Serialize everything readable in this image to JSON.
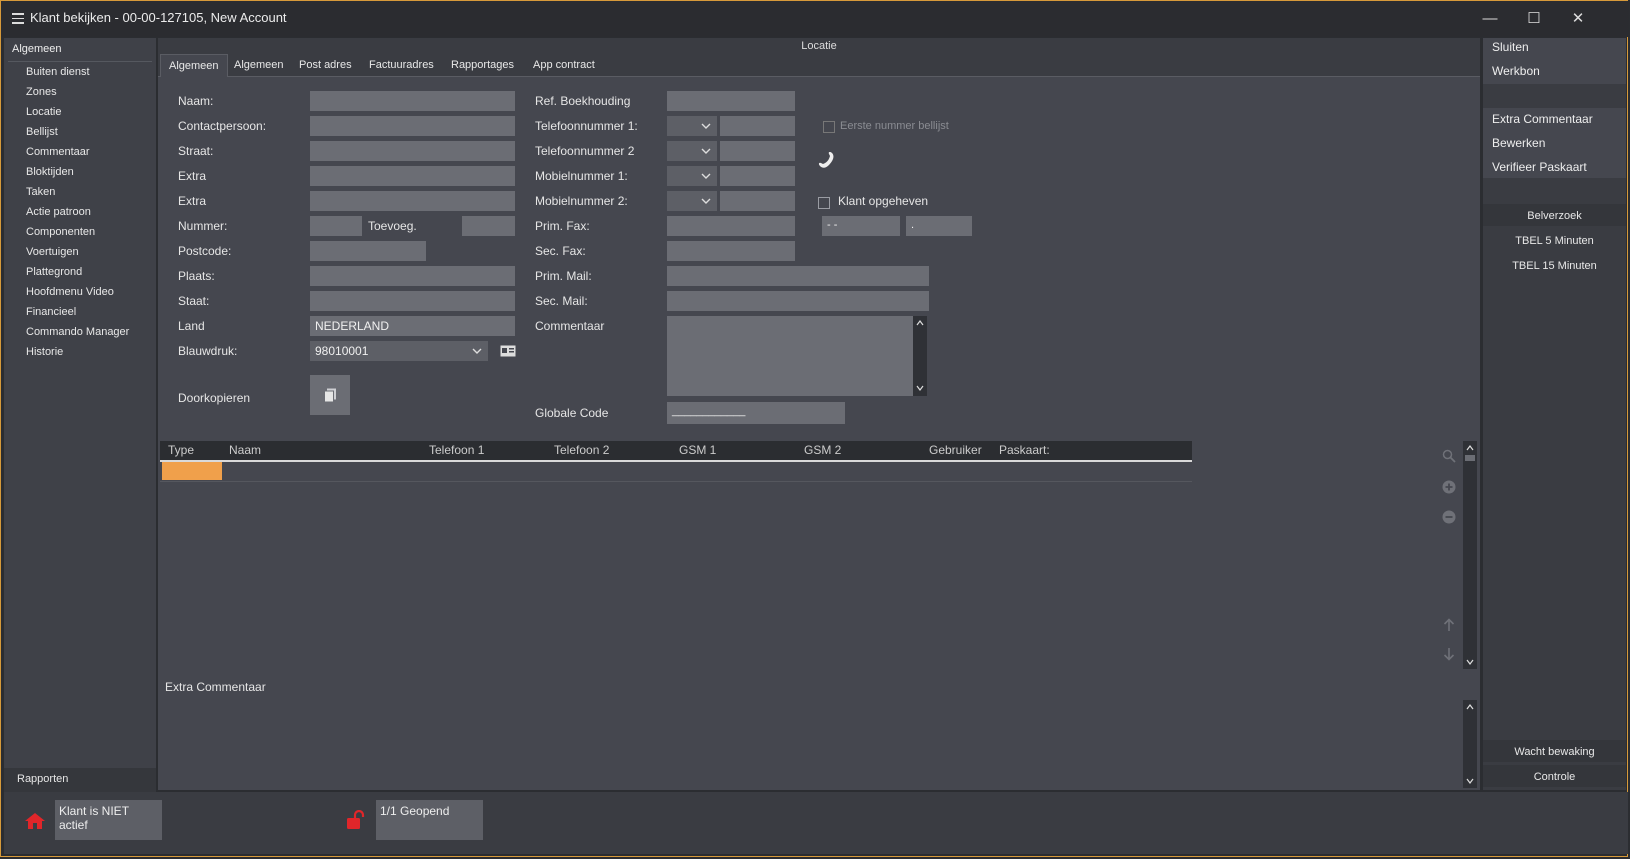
{
  "window": {
    "title": "Klant bekijken - 00-00-127105, New Account",
    "controls": {
      "minimize": "—",
      "maximize": "☐",
      "close": "✕"
    }
  },
  "sidebar": {
    "header": "Algemeen",
    "items": [
      {
        "label": "Buiten dienst"
      },
      {
        "label": "Zones"
      },
      {
        "label": "Locatie"
      },
      {
        "label": "Bellijst"
      },
      {
        "label": "Commentaar"
      },
      {
        "label": "Bloktijden"
      },
      {
        "label": "Taken"
      },
      {
        "label": "Actie patroon"
      },
      {
        "label": "Componenten"
      },
      {
        "label": "Voertuigen"
      },
      {
        "label": "Plattegrond"
      },
      {
        "label": "Hoofdmenu Video"
      },
      {
        "label": "Financieel"
      },
      {
        "label": "Commando Manager"
      },
      {
        "label": "Historie"
      }
    ],
    "footer": "Rapporten"
  },
  "main": {
    "section_title": "Locatie",
    "tabs": [
      {
        "label": "Algemeen"
      },
      {
        "label": "Algemeen"
      },
      {
        "label": "Post adres"
      },
      {
        "label": "Factuuradres"
      },
      {
        "label": "Rapportages"
      },
      {
        "label": "App contract"
      }
    ],
    "left_form": {
      "naam": "Naam:",
      "contactpersoon": "Contactpersoon:",
      "straat": "Straat:",
      "extra1": "Extra",
      "extra2": "Extra",
      "nummer": "Nummer:",
      "toevoeg": "Toevoeg.",
      "postcode": "Postcode:",
      "plaats": "Plaats:",
      "staat": "Staat:",
      "land": "Land",
      "land_value": "NEDERLAND",
      "blauwdruk": "Blauwdruk:",
      "blauwdruk_value": "98010001",
      "doorkopieren": "Doorkopieren"
    },
    "right_form": {
      "ref_boekhouding": "Ref. Boekhouding",
      "tel1": "Telefoonnummer 1:",
      "tel2": "Telefoonnummer 2",
      "mob1": "Mobielnummer 1:",
      "mob2": "Mobielnummer 2:",
      "prim_fax": "Prim. Fax:",
      "sec_fax": "Sec. Fax:",
      "prim_mail": "Prim. Mail:",
      "sec_mail": "Sec. Mail:",
      "commentaar": "Commentaar",
      "globale_code": "Globale Code",
      "globale_code_value": "____________"
    },
    "extra_options": {
      "eerste_nummer": "Eerste nummer bellijst",
      "klant_opgeheven": "Klant opgeheven",
      "date_value": " -  -",
      "time_value": "."
    },
    "grid": {
      "columns": [
        "Type",
        "Naam",
        "Telefoon 1",
        "Telefoon 2",
        "GSM 1",
        "GSM 2",
        "Gebruiker",
        "Paskaart:"
      ]
    },
    "extra_commentaar": "Extra Commentaar"
  },
  "right_panel": {
    "top_items": [
      "Sluiten",
      "Werkbon"
    ],
    "mid_items": [
      "Extra Commentaar",
      "Bewerken",
      "Verifieer Paskaart"
    ],
    "belverzoek": "Belverzoek",
    "tbel": [
      "TBEL 5 Minuten",
      "TBEL 15 Minuten"
    ],
    "wacht_bewaking": "Wacht bewaking",
    "controle": "Controle"
  },
  "status": {
    "klant_status": "Klant is NIET actief",
    "geopend": "1/1 Geopend"
  },
  "colors": {
    "accent": "#f0a04b",
    "frame": "#d79a3a",
    "alert": "#e0262a"
  }
}
